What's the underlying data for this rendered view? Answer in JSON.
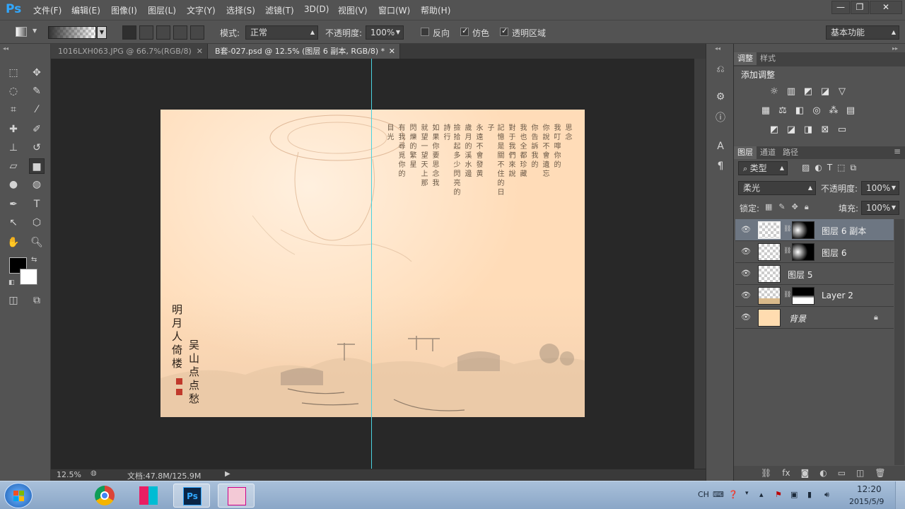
{
  "app": {
    "logo": "Ps",
    "menus": [
      "文件(F)",
      "编辑(E)",
      "图像(I)",
      "图层(L)",
      "文字(Y)",
      "选择(S)",
      "滤镜(T)",
      "3D(D)",
      "视图(V)",
      "窗口(W)",
      "帮助(H)"
    ],
    "window_buttons": {
      "minimize": "—",
      "restore": "❐",
      "close": "✕"
    }
  },
  "options": {
    "mode_label": "模式:",
    "mode_value": "正常",
    "opacity_label": "不透明度:",
    "opacity_value": "100%",
    "reverse_label": "反向",
    "reverse_checked": false,
    "dither_label": "仿色",
    "dither_checked": true,
    "transparency_label": "透明区域",
    "transparency_checked": true,
    "workspace": "基本功能"
  },
  "tabs": [
    {
      "label": "1016LXH063.JPG @ 66.7%(RGB/8)",
      "close": "✕",
      "active": false
    },
    {
      "label": "B套-027.psd @ 12.5% (图层 6 副本, RGB/8) *",
      "close": "✕",
      "active": true
    }
  ],
  "status": {
    "zoom": "12.5%",
    "doc_info": "文档:47.8M/125.9M"
  },
  "artwork": {
    "poem_columns": [
      "思念",
      "我叮嚀你的",
      "你說不會遺忘",
      "你告訴我的",
      "我也全都珍藏",
      "對于我們來說",
      "記憶是關不住的日子",
      "永遠不會發黄",
      "歲月的溪水邊",
      "撿拾起多少閃亮的詩行",
      "如果你要思念我",
      "就望一望天上那",
      "閃爍的繁星",
      "有我尋覓你的",
      "目光"
    ],
    "calligraphy_left": [
      "明月人倚楼"
    ],
    "calligraphy_right": [
      "吴山点点愁"
    ]
  },
  "panels": {
    "adjust_tab": "调整",
    "style_tab": "样式",
    "add_adjust": "添加调整",
    "layers_tab": "图层",
    "channels_tab": "通道",
    "paths_tab": "路径",
    "filter_kind": "类型",
    "blend_mode": "柔光",
    "opacity_label": "不透明度:",
    "opacity_value": "100%",
    "lock_label": "锁定:",
    "fill_label": "填充:",
    "fill_value": "100%",
    "layers": [
      {
        "name": "图层 6 副本",
        "selected": true,
        "mask": true
      },
      {
        "name": "图层 6",
        "selected": false,
        "mask": true
      },
      {
        "name": "图层 5",
        "selected": false,
        "mask": false
      },
      {
        "name": "Layer 2",
        "selected": false,
        "mask": true
      },
      {
        "name": "背景",
        "selected": false,
        "mask": false,
        "locked": true
      }
    ]
  },
  "taskbar": {
    "lang": "CH",
    "time": "12:20",
    "date": "2015/5/9"
  },
  "colors": {
    "accent": "#31a8ff",
    "guide": "#4ad2e0",
    "paper": "#ffdcb8",
    "selected_layer": "#6d7682"
  }
}
